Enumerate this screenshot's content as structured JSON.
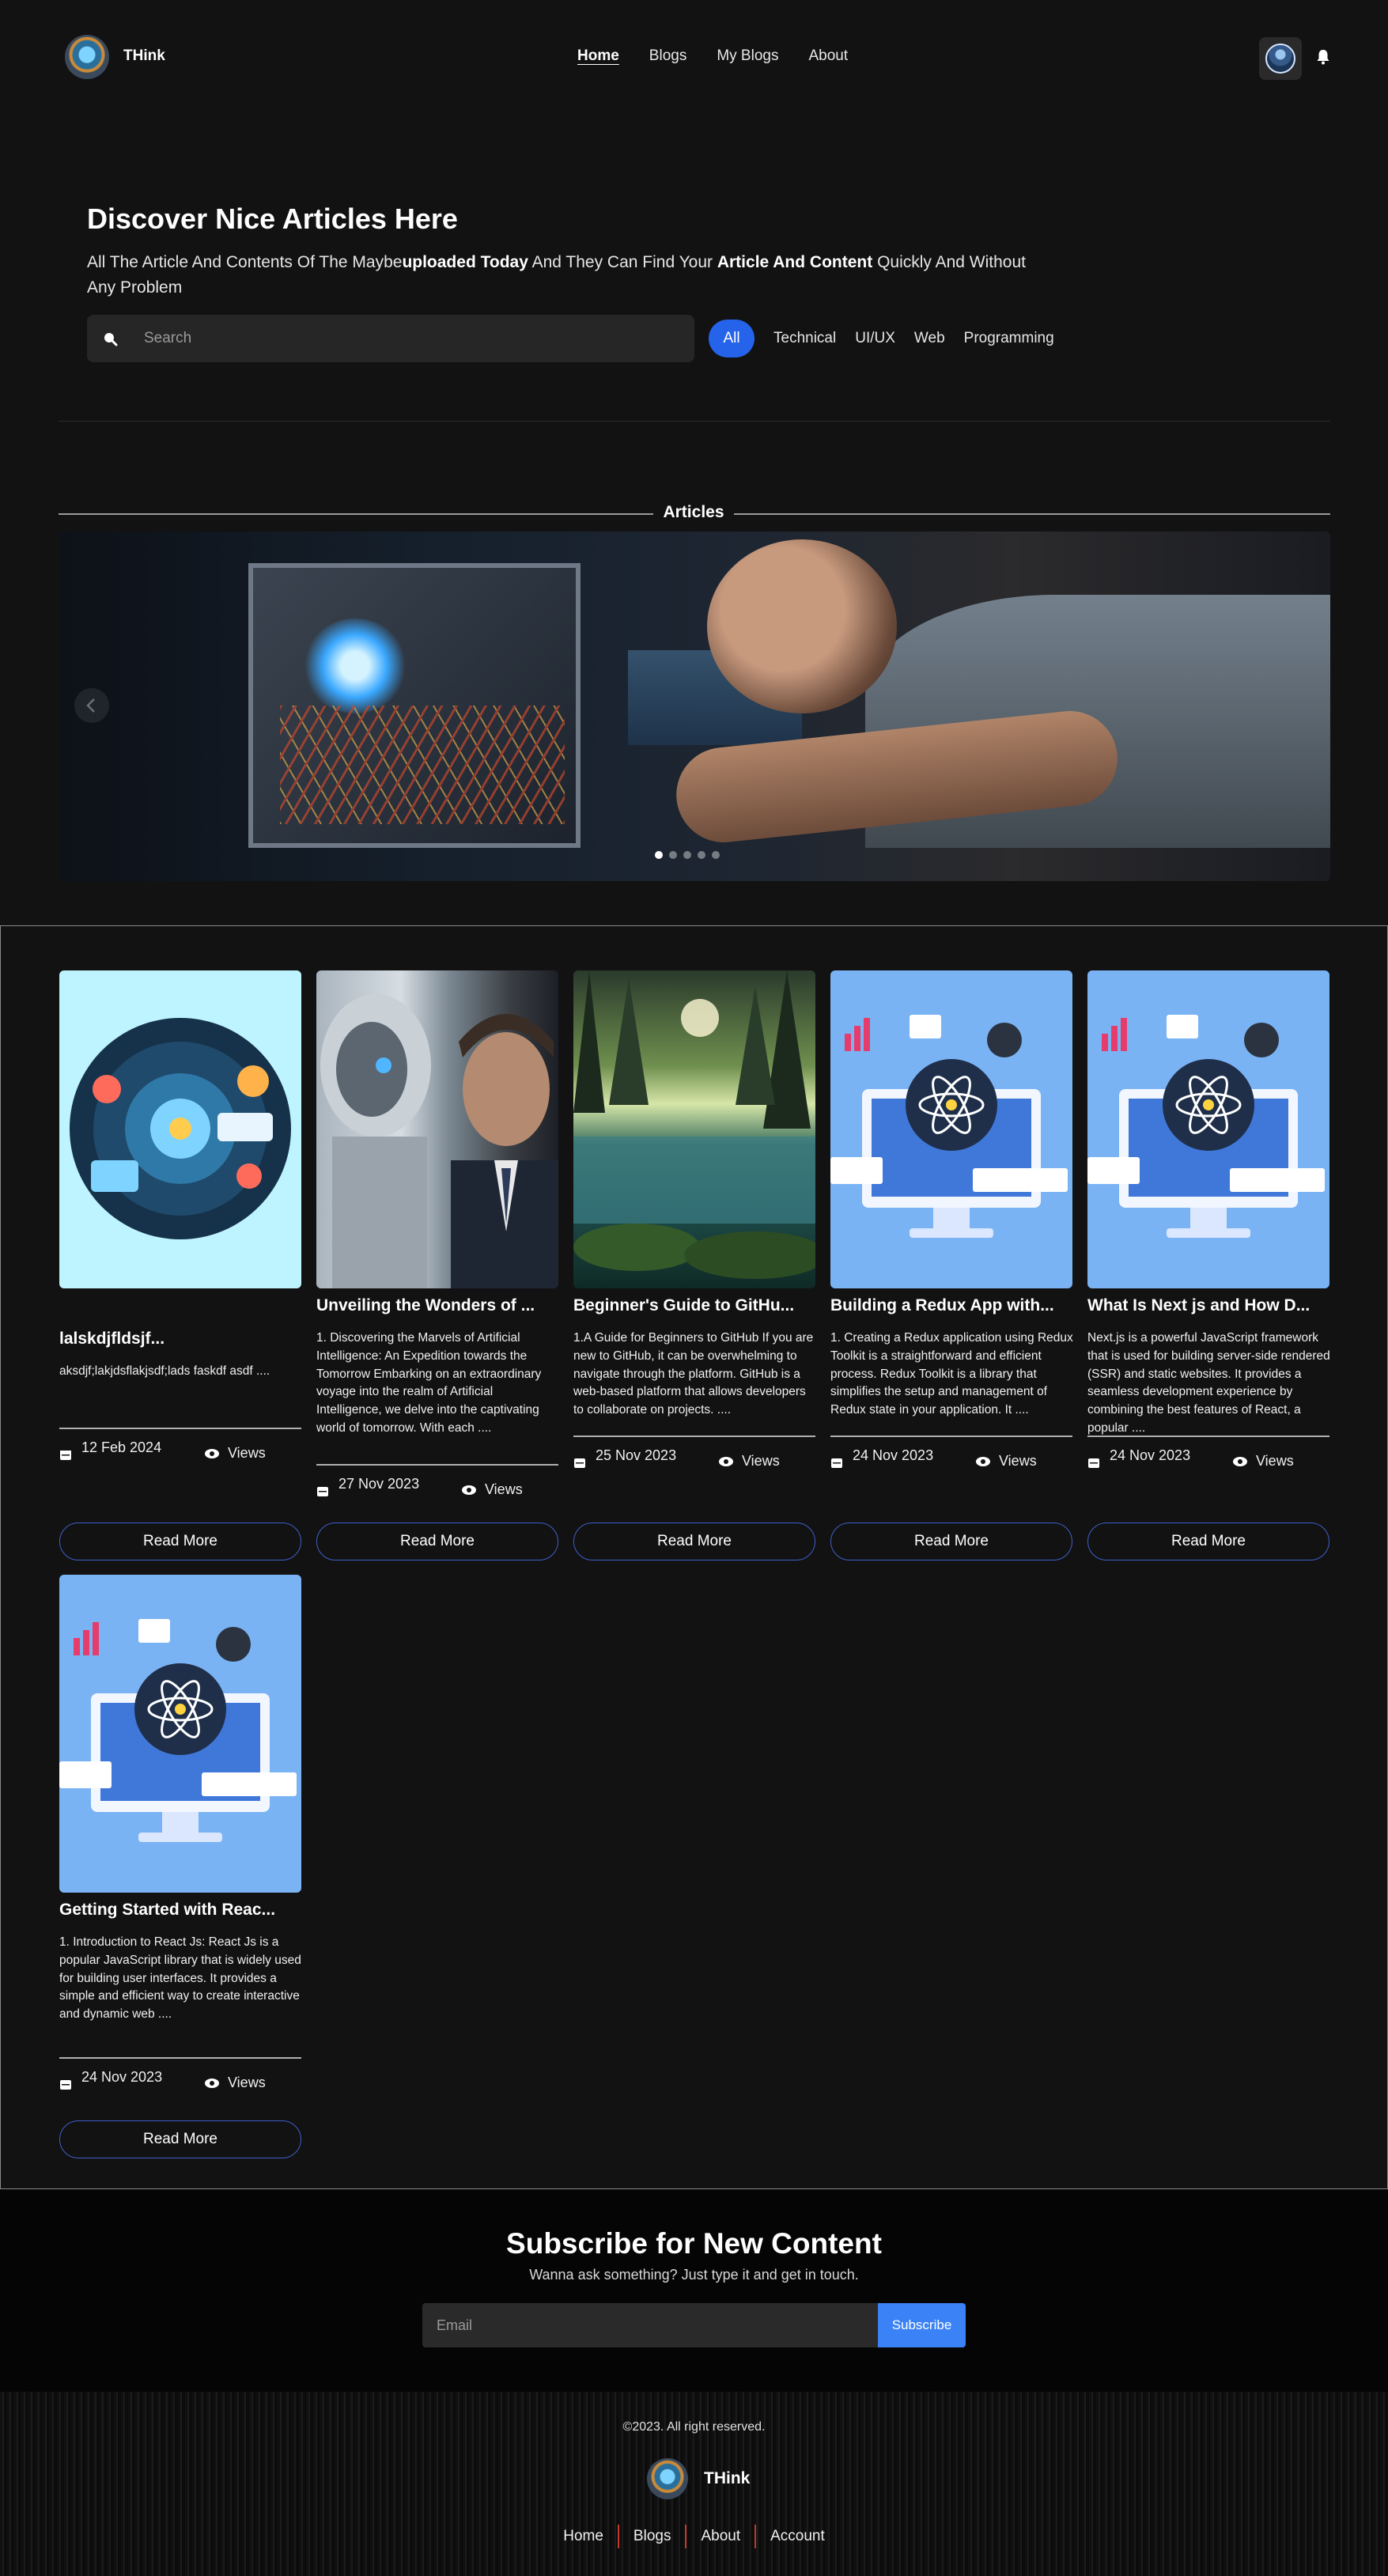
{
  "header": {
    "brand": "THink",
    "nav": [
      "Home",
      "Blogs",
      "My Blogs",
      "About"
    ],
    "active_nav": "Home"
  },
  "hero": {
    "title": "Discover Nice Articles Here",
    "subtitle_parts": [
      "All The Article And Contents Of The Maybe",
      "uploaded Today",
      " And They Can Find Your ",
      "Article And Content",
      " Quickly And Without Any Problem"
    ],
    "search_placeholder": "Search",
    "filters": [
      "All",
      "Technical",
      "UI/UX",
      "Web",
      "Programming"
    ],
    "active_filter": "All"
  },
  "articles_section": {
    "title": "Articles",
    "carousel_dots": 5,
    "active_dot": 0
  },
  "cards": [
    {
      "title": "lalskdjfldsjf...",
      "description": "aksdjf;lakjdsflakjsdf;lads faskdf asdf ....",
      "date": "12 Feb 2024",
      "views_label": "Views",
      "button": "Read More",
      "image": "ai-brain-illustration"
    },
    {
      "title": "Unveiling the Wonders of ...",
      "description": "1. Discovering the Marvels of Artificial Intelligence: An Expedition towards the Tomorrow Embarking on an extraordinary voyage into the realm of Artificial Intelligence, we delve into the captivating world of tomorrow. With each ....",
      "date": "27 Nov 2023",
      "views_label": "Views",
      "button": "Read More",
      "image": "robot-and-man-photo"
    },
    {
      "title": "Beginner's Guide to GitHu...",
      "description": "1.A Guide for Beginners to GitHub If you are new to GitHub, it can be overwhelming to navigate through the platform. GitHub is a web-based platform that allows developers to collaborate on projects. ....",
      "date": "25 Nov 2023",
      "views_label": "Views",
      "button": "Read More",
      "image": "forest-river-photo"
    },
    {
      "title": "Building a Redux App with...",
      "description": "1. Creating a Redux application using Redux Toolkit is a straightforward and efficient process. Redux Toolkit is a library that simplifies the setup and management of Redux state in your application. It ....",
      "date": "24 Nov 2023",
      "views_label": "Views",
      "button": "Read More",
      "image": "react-computer-illustration"
    },
    {
      "title": "What Is Next js and How D...",
      "description": "Next.js is a powerful JavaScript framework that is used for building server-side rendered (SSR) and static websites. It provides a seamless development experience by combining the best features of React, a popular ....",
      "date": "24 Nov 2023",
      "views_label": "Views",
      "button": "Read More",
      "image": "react-computer-illustration"
    },
    {
      "title": "Getting Started with Reac...",
      "description": "1. Introduction to React Js: React Js is a popular JavaScript library that is widely used for building user interfaces. It provides a simple and efficient way to create interactive and dynamic web ....",
      "date": "24 Nov 2023",
      "views_label": "Views",
      "button": "Read More",
      "image": "react-computer-illustration"
    }
  ],
  "subscribe": {
    "title": "Subscribe for New Content",
    "description": "Wanna ask something? Just type it and get in touch.",
    "email_placeholder": "Email",
    "button": "Subscribe"
  },
  "footer": {
    "copyright": "©2023. All right reserved.",
    "brand": "THink",
    "links": [
      "Home",
      "Blogs",
      "About",
      "Account"
    ]
  },
  "colors": {
    "background": "#121212",
    "accent": "#2563eb",
    "subscribe_button": "#3b82f6",
    "footer_separator": "#c0392b"
  }
}
